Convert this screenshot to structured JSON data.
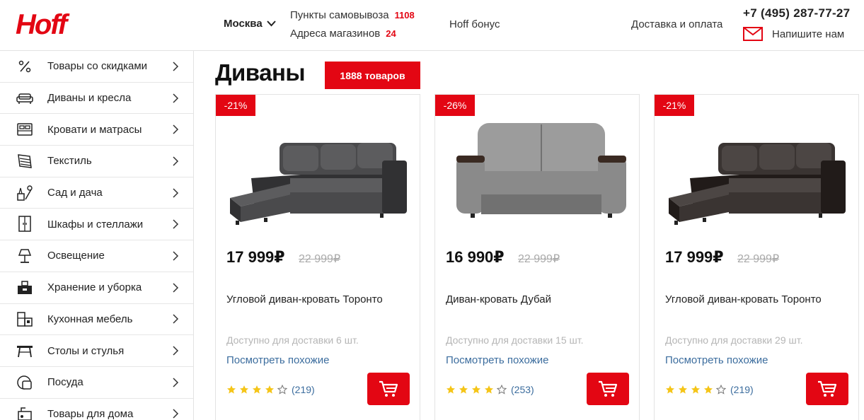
{
  "header": {
    "logo_text": "Hoff",
    "city": "Москва",
    "pickup_label": "Пункты самовывоза",
    "pickup_count": "1108",
    "stores_label": "Адреса магазинов",
    "stores_count": "24",
    "bonus": "Hoff бонус",
    "delivery": "Доставка и оплата",
    "phone": "+7 (495) 287-77-27",
    "write_us": "Напишите нам"
  },
  "sidebar": {
    "items": [
      {
        "label": "Товары со скидками",
        "icon": "percent-icon"
      },
      {
        "label": "Диваны и кресла",
        "icon": "sofa-icon"
      },
      {
        "label": "Кровати и матрасы",
        "icon": "bed-icon"
      },
      {
        "label": "Текстиль",
        "icon": "textile-icon"
      },
      {
        "label": "Сад и дача",
        "icon": "garden-icon"
      },
      {
        "label": "Шкафы и стеллажи",
        "icon": "wardrobe-icon"
      },
      {
        "label": "Освещение",
        "icon": "lamp-icon"
      },
      {
        "label": "Хранение и уборка",
        "icon": "storage-icon"
      },
      {
        "label": "Кухонная мебель",
        "icon": "kitchen-icon"
      },
      {
        "label": "Столы и стулья",
        "icon": "table-icon"
      },
      {
        "label": "Посуда",
        "icon": "dishes-icon"
      },
      {
        "label": "Товары для дома",
        "icon": "home-goods-icon"
      }
    ]
  },
  "main": {
    "title": "Диваны",
    "count_badge": "1888 товаров",
    "products": [
      {
        "discount": "-21%",
        "price": "17 999₽",
        "old_price": "22 999₽",
        "name": "Угловой диван-кровать Торонто",
        "availability": "Доступно для доставки 6 шт.",
        "similar": "Посмотреть похожие",
        "rating": 4,
        "reviews": "(219)",
        "sofa_color": "#4a4a4c",
        "sofa_type": "corner"
      },
      {
        "discount": "-26%",
        "price": "16 990₽",
        "old_price": "22 999₽",
        "name": "Диван-кровать Дубай",
        "availability": "Доступно для доставки 15 шт.",
        "similar": "Посмотреть похожие",
        "rating": 4,
        "reviews": "(253)",
        "sofa_color": "#8a8a8a",
        "sofa_type": "straight"
      },
      {
        "discount": "-21%",
        "price": "17 999₽",
        "old_price": "22 999₽",
        "name": "Угловой диван-кровать Торонто",
        "availability": "Доступно для доставки 29 шт.",
        "similar": "Посмотреть похожие",
        "rating": 4,
        "reviews": "(219)",
        "sofa_color": "#3a3432",
        "sofa_type": "corner"
      }
    ]
  },
  "colors": {
    "brand_red": "#e30613",
    "link_blue": "#3c6d9e",
    "star_yellow": "#f5c518"
  }
}
